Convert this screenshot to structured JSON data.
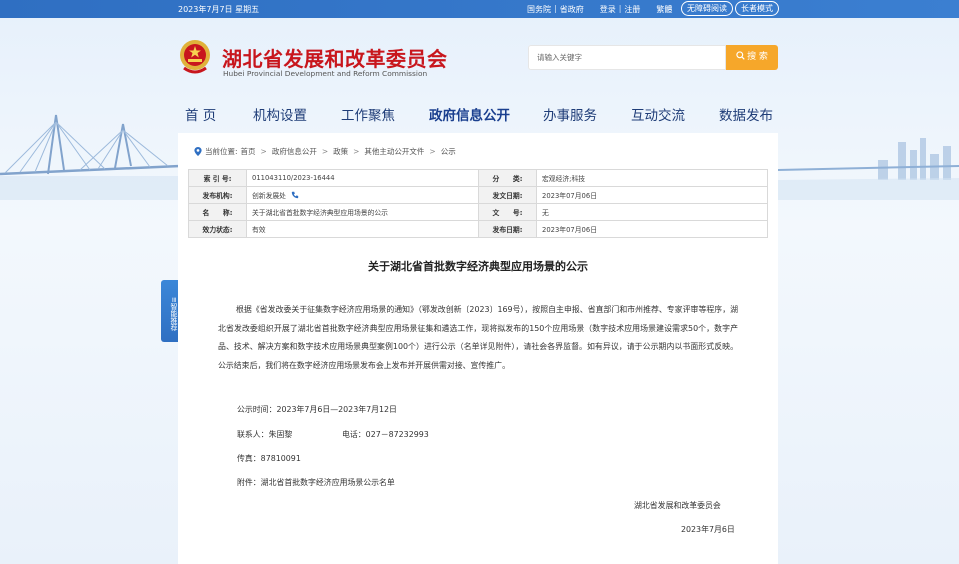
{
  "topbar": {
    "date": "2023年7月7日 星期五",
    "links": [
      "国务院",
      "省政府",
      "登录",
      "注册",
      "繁體"
    ],
    "accessibility": "无障碍阅读",
    "elder_mode": "长者模式"
  },
  "header": {
    "title": "湖北省发展和改革委员会",
    "subtitle": "Hubei Provincial Development and Reform Commission",
    "search_placeholder": "请输入关键字",
    "search_button": "搜 索"
  },
  "nav": {
    "items": [
      "首 页",
      "机构设置",
      "工作聚焦",
      "政府信息公开",
      "办事服务",
      "互动交流",
      "数据发布"
    ],
    "active_index": 3
  },
  "breadcrumb": {
    "prefix": "当前位置:",
    "items": [
      "首页",
      "政府信息公开",
      "政策",
      "其他主动公开文件",
      "公示"
    ]
  },
  "info": {
    "index_no_label": "索 引 号:",
    "index_no": "011043110/2023-16444",
    "category_label": "分　　类:",
    "category": "宏观经济;科技",
    "publisher_label": "发布机构:",
    "publisher": "创新发展处",
    "publish_date_label": "发文日期:",
    "publish_date": "2023年07月06日",
    "name_label": "名　　称:",
    "name": "关于湖北省首批数字经济典型应用场景的公示",
    "doc_no_label": "文　　号:",
    "doc_no": "无",
    "status_label": "效力状态:",
    "status": "有效",
    "release_date_label": "发布日期:",
    "release_date": "2023年07月06日"
  },
  "article": {
    "title": "关于湖北省首批数字经济典型应用场景的公示",
    "paragraph": "根据《省发改委关于征集数字经济应用场景的通知》（鄂发改创新〔2023〕169号），按照自主申报、省直部门和市州推荐、专家评审等程序，湖北省发改委组织开展了湖北省首批数字经济典型应用场景征集和遴选工作，现将拟发布的150个应用场景（数字技术应用场景建设需求50个，数字产品、技术、解决方案和数字技术应用场景典型案例100个）进行公示（名单详见附件），请社会各界监督。如有异议，请于公示期内以书面形式反映。公示结束后，我们将在数字经济应用场景发布会上发布并开展供需对接、宣传推广。",
    "period": "公示时间：2023年7月6日—2023年7月12日",
    "contact": "联系人：朱固黎",
    "phone": "电话：027－87232993",
    "fax": "传真：87810091",
    "attachment": "附件：湖北省首批数字经济应用场景公示名单",
    "signer": "湖北省发展和改革委员会",
    "sign_date": "2023年7月6日"
  },
  "side": {
    "label": "智能推荐"
  },
  "colors": {
    "brand_red": "#c8161d",
    "nav_blue": "#1f3d78",
    "search_orange": "#f6a72a",
    "topbar_blue": "#2f6fc2"
  }
}
